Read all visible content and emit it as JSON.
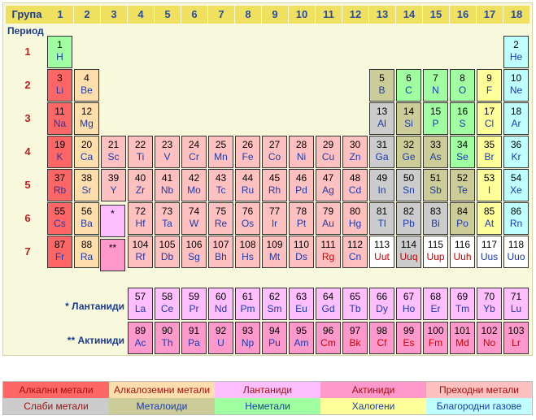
{
  "header": {
    "group_label": "Група",
    "groups": [
      "1",
      "2",
      "3",
      "4",
      "5",
      "6",
      "7",
      "8",
      "9",
      "10",
      "11",
      "12",
      "13",
      "14",
      "15",
      "16",
      "17",
      "18"
    ]
  },
  "period_label": "Период",
  "periods": [
    "1",
    "2",
    "3",
    "4",
    "5",
    "6",
    "7"
  ],
  "families": {
    "lanthanides_label": "* Лантаниди",
    "actinides_label": "** Актиниди",
    "lanthanide_marker": "*",
    "actinide_marker": "**"
  },
  "colors": {
    "alkali": "#ff6666",
    "alkaline_earth": "#ffdead",
    "lanthanide": "#ffbfff",
    "actinide": "#ff99cc",
    "transition": "#ffc0c0",
    "poor_metal": "#cccccc",
    "metalloid": "#cccc99",
    "nonmetal": "#a0ffa0",
    "halogen": "#ffff99",
    "noble_gas": "#c0ffff"
  },
  "elements": [
    {
      "n": "1",
      "s": "H",
      "r": 1,
      "c": 1,
      "t": "nonmetal"
    },
    {
      "n": "2",
      "s": "He",
      "r": 1,
      "c": 18,
      "t": "noble_gas"
    },
    {
      "n": "3",
      "s": "Li",
      "r": 2,
      "c": 1,
      "t": "alkali"
    },
    {
      "n": "4",
      "s": "Be",
      "r": 2,
      "c": 2,
      "t": "alkaline_earth"
    },
    {
      "n": "5",
      "s": "B",
      "r": 2,
      "c": 13,
      "t": "metalloid"
    },
    {
      "n": "6",
      "s": "C",
      "r": 2,
      "c": 14,
      "t": "nonmetal"
    },
    {
      "n": "7",
      "s": "N",
      "r": 2,
      "c": 15,
      "t": "nonmetal"
    },
    {
      "n": "8",
      "s": "O",
      "r": 2,
      "c": 16,
      "t": "nonmetal"
    },
    {
      "n": "9",
      "s": "F",
      "r": 2,
      "c": 17,
      "t": "halogen"
    },
    {
      "n": "10",
      "s": "Ne",
      "r": 2,
      "c": 18,
      "t": "noble_gas"
    },
    {
      "n": "11",
      "s": "Na",
      "r": 3,
      "c": 1,
      "t": "alkali"
    },
    {
      "n": "12",
      "s": "Mg",
      "r": 3,
      "c": 2,
      "t": "alkaline_earth"
    },
    {
      "n": "13",
      "s": "Al",
      "r": 3,
      "c": 13,
      "t": "poor_metal"
    },
    {
      "n": "14",
      "s": "Si",
      "r": 3,
      "c": 14,
      "t": "metalloid"
    },
    {
      "n": "15",
      "s": "P",
      "r": 3,
      "c": 15,
      "t": "nonmetal"
    },
    {
      "n": "16",
      "s": "S",
      "r": 3,
      "c": 16,
      "t": "nonmetal"
    },
    {
      "n": "17",
      "s": "Cl",
      "r": 3,
      "c": 17,
      "t": "halogen"
    },
    {
      "n": "18",
      "s": "Ar",
      "r": 3,
      "c": 18,
      "t": "noble_gas"
    },
    {
      "n": "19",
      "s": "K",
      "r": 4,
      "c": 1,
      "t": "alkali"
    },
    {
      "n": "20",
      "s": "Ca",
      "r": 4,
      "c": 2,
      "t": "alkaline_earth"
    },
    {
      "n": "21",
      "s": "Sc",
      "r": 4,
      "c": 3,
      "t": "transition"
    },
    {
      "n": "22",
      "s": "Ti",
      "r": 4,
      "c": 4,
      "t": "transition"
    },
    {
      "n": "23",
      "s": "V",
      "r": 4,
      "c": 5,
      "t": "transition"
    },
    {
      "n": "24",
      "s": "Cr",
      "r": 4,
      "c": 6,
      "t": "transition"
    },
    {
      "n": "25",
      "s": "Mn",
      "r": 4,
      "c": 7,
      "t": "transition"
    },
    {
      "n": "26",
      "s": "Fe",
      "r": 4,
      "c": 8,
      "t": "transition"
    },
    {
      "n": "27",
      "s": "Co",
      "r": 4,
      "c": 9,
      "t": "transition"
    },
    {
      "n": "28",
      "s": "Ni",
      "r": 4,
      "c": 10,
      "t": "transition"
    },
    {
      "n": "29",
      "s": "Cu",
      "r": 4,
      "c": 11,
      "t": "transition"
    },
    {
      "n": "30",
      "s": "Zn",
      "r": 4,
      "c": 12,
      "t": "transition"
    },
    {
      "n": "31",
      "s": "Ga",
      "r": 4,
      "c": 13,
      "t": "poor_metal"
    },
    {
      "n": "32",
      "s": "Ge",
      "r": 4,
      "c": 14,
      "t": "metalloid"
    },
    {
      "n": "33",
      "s": "As",
      "r": 4,
      "c": 15,
      "t": "metalloid"
    },
    {
      "n": "34",
      "s": "Se",
      "r": 4,
      "c": 16,
      "t": "nonmetal"
    },
    {
      "n": "35",
      "s": "Br",
      "r": 4,
      "c": 17,
      "t": "halogen"
    },
    {
      "n": "36",
      "s": "Kr",
      "r": 4,
      "c": 18,
      "t": "noble_gas"
    },
    {
      "n": "37",
      "s": "Rb",
      "r": 5,
      "c": 1,
      "t": "alkali"
    },
    {
      "n": "38",
      "s": "Sr",
      "r": 5,
      "c": 2,
      "t": "alkaline_earth"
    },
    {
      "n": "39",
      "s": "Y",
      "r": 5,
      "c": 3,
      "t": "transition"
    },
    {
      "n": "40",
      "s": "Zr",
      "r": 5,
      "c": 4,
      "t": "transition"
    },
    {
      "n": "41",
      "s": "Nb",
      "r": 5,
      "c": 5,
      "t": "transition"
    },
    {
      "n": "42",
      "s": "Mo",
      "r": 5,
      "c": 6,
      "t": "transition"
    },
    {
      "n": "43",
      "s": "Tc",
      "r": 5,
      "c": 7,
      "t": "transition"
    },
    {
      "n": "44",
      "s": "Ru",
      "r": 5,
      "c": 8,
      "t": "transition"
    },
    {
      "n": "45",
      "s": "Rh",
      "r": 5,
      "c": 9,
      "t": "transition"
    },
    {
      "n": "46",
      "s": "Pd",
      "r": 5,
      "c": 10,
      "t": "transition"
    },
    {
      "n": "47",
      "s": "Ag",
      "r": 5,
      "c": 11,
      "t": "transition"
    },
    {
      "n": "48",
      "s": "Cd",
      "r": 5,
      "c": 12,
      "t": "transition"
    },
    {
      "n": "49",
      "s": "In",
      "r": 5,
      "c": 13,
      "t": "poor_metal"
    },
    {
      "n": "50",
      "s": "Sn",
      "r": 5,
      "c": 14,
      "t": "poor_metal"
    },
    {
      "n": "51",
      "s": "Sb",
      "r": 5,
      "c": 15,
      "t": "metalloid"
    },
    {
      "n": "52",
      "s": "Te",
      "r": 5,
      "c": 16,
      "t": "metalloid"
    },
    {
      "n": "53",
      "s": "I",
      "r": 5,
      "c": 17,
      "t": "halogen"
    },
    {
      "n": "54",
      "s": "Xe",
      "r": 5,
      "c": 18,
      "t": "noble_gas"
    },
    {
      "n": "55",
      "s": "Cs",
      "r": 6,
      "c": 1,
      "t": "alkali"
    },
    {
      "n": "56",
      "s": "Ba",
      "r": 6,
      "c": 2,
      "t": "alkaline_earth"
    },
    {
      "n": "72",
      "s": "Hf",
      "r": 6,
      "c": 4,
      "t": "transition"
    },
    {
      "n": "73",
      "s": "Ta",
      "r": 6,
      "c": 5,
      "t": "transition"
    },
    {
      "n": "74",
      "s": "W",
      "r": 6,
      "c": 6,
      "t": "transition"
    },
    {
      "n": "75",
      "s": "Re",
      "r": 6,
      "c": 7,
      "t": "transition"
    },
    {
      "n": "76",
      "s": "Os",
      "r": 6,
      "c": 8,
      "t": "transition"
    },
    {
      "n": "77",
      "s": "Ir",
      "r": 6,
      "c": 9,
      "t": "transition"
    },
    {
      "n": "78",
      "s": "Pt",
      "r": 6,
      "c": 10,
      "t": "transition"
    },
    {
      "n": "79",
      "s": "Au",
      "r": 6,
      "c": 11,
      "t": "transition"
    },
    {
      "n": "80",
      "s": "Hg",
      "r": 6,
      "c": 12,
      "t": "transition"
    },
    {
      "n": "81",
      "s": "Tl",
      "r": 6,
      "c": 13,
      "t": "poor_metal"
    },
    {
      "n": "82",
      "s": "Pb",
      "r": 6,
      "c": 14,
      "t": "poor_metal"
    },
    {
      "n": "83",
      "s": "Bi",
      "r": 6,
      "c": 15,
      "t": "poor_metal"
    },
    {
      "n": "84",
      "s": "Po",
      "r": 6,
      "c": 16,
      "t": "metalloid"
    },
    {
      "n": "85",
      "s": "At",
      "r": 6,
      "c": 17,
      "t": "halogen"
    },
    {
      "n": "86",
      "s": "Rn",
      "r": 6,
      "c": 18,
      "t": "noble_gas"
    },
    {
      "n": "87",
      "s": "Fr",
      "r": 7,
      "c": 1,
      "t": "alkali"
    },
    {
      "n": "88",
      "s": "Ra",
      "r": 7,
      "c": 2,
      "t": "alkaline_earth"
    },
    {
      "n": "104",
      "s": "Rf",
      "r": 7,
      "c": 4,
      "t": "transition"
    },
    {
      "n": "105",
      "s": "Db",
      "r": 7,
      "c": 5,
      "t": "transition"
    },
    {
      "n": "106",
      "s": "Sg",
      "r": 7,
      "c": 6,
      "t": "transition"
    },
    {
      "n": "107",
      "s": "Bh",
      "r": 7,
      "c": 7,
      "t": "transition"
    },
    {
      "n": "108",
      "s": "Hs",
      "r": 7,
      "c": 8,
      "t": "transition"
    },
    {
      "n": "109",
      "s": "Mt",
      "r": 7,
      "c": 9,
      "t": "transition"
    },
    {
      "n": "110",
      "s": "Ds",
      "r": 7,
      "c": 10,
      "t": "transition"
    },
    {
      "n": "111",
      "s": "Rg",
      "r": 7,
      "c": 11,
      "t": "transition",
      "red": true
    },
    {
      "n": "112",
      "s": "Cn",
      "r": 7,
      "c": 12,
      "t": "transition"
    },
    {
      "n": "113",
      "s": "Uut",
      "r": 7,
      "c": 13,
      "t": "unknown",
      "red": true
    },
    {
      "n": "114",
      "s": "Uuq",
      "r": 7,
      "c": 14,
      "t": "poor_metal",
      "red": true
    },
    {
      "n": "115",
      "s": "Uup",
      "r": 7,
      "c": 15,
      "t": "unknown",
      "red": true
    },
    {
      "n": "116",
      "s": "Uuh",
      "r": 7,
      "c": 16,
      "t": "unknown",
      "red": true
    },
    {
      "n": "117",
      "s": "Uus",
      "r": 7,
      "c": 17,
      "t": "unknown"
    },
    {
      "n": "118",
      "s": "Uuo",
      "r": 7,
      "c": 18,
      "t": "unknown"
    },
    {
      "n": "57",
      "s": "La",
      "r": 8,
      "c": 4,
      "t": "lanthanide"
    },
    {
      "n": "58",
      "s": "Ce",
      "r": 8,
      "c": 5,
      "t": "lanthanide"
    },
    {
      "n": "59",
      "s": "Pr",
      "r": 8,
      "c": 6,
      "t": "lanthanide"
    },
    {
      "n": "60",
      "s": "Nd",
      "r": 8,
      "c": 7,
      "t": "lanthanide"
    },
    {
      "n": "61",
      "s": "Pm",
      "r": 8,
      "c": 8,
      "t": "lanthanide"
    },
    {
      "n": "62",
      "s": "Sm",
      "r": 8,
      "c": 9,
      "t": "lanthanide"
    },
    {
      "n": "63",
      "s": "Eu",
      "r": 8,
      "c": 10,
      "t": "lanthanide"
    },
    {
      "n": "64",
      "s": "Gd",
      "r": 8,
      "c": 11,
      "t": "lanthanide"
    },
    {
      "n": "65",
      "s": "Tb",
      "r": 8,
      "c": 12,
      "t": "lanthanide"
    },
    {
      "n": "66",
      "s": "Dy",
      "r": 8,
      "c": 13,
      "t": "lanthanide"
    },
    {
      "n": "67",
      "s": "Ho",
      "r": 8,
      "c": 14,
      "t": "lanthanide"
    },
    {
      "n": "68",
      "s": "Er",
      "r": 8,
      "c": 15,
      "t": "lanthanide"
    },
    {
      "n": "69",
      "s": "Tm",
      "r": 8,
      "c": 16,
      "t": "lanthanide"
    },
    {
      "n": "70",
      "s": "Yb",
      "r": 8,
      "c": 17,
      "t": "lanthanide"
    },
    {
      "n": "71",
      "s": "Lu",
      "r": 8,
      "c": 18,
      "t": "lanthanide"
    },
    {
      "n": "89",
      "s": "Ac",
      "r": 9,
      "c": 4,
      "t": "actinide"
    },
    {
      "n": "90",
      "s": "Th",
      "r": 9,
      "c": 5,
      "t": "actinide"
    },
    {
      "n": "91",
      "s": "Pa",
      "r": 9,
      "c": 6,
      "t": "actinide"
    },
    {
      "n": "92",
      "s": "U",
      "r": 9,
      "c": 7,
      "t": "actinide"
    },
    {
      "n": "93",
      "s": "Np",
      "r": 9,
      "c": 8,
      "t": "actinide"
    },
    {
      "n": "94",
      "s": "Pu",
      "r": 9,
      "c": 9,
      "t": "actinide"
    },
    {
      "n": "95",
      "s": "Am",
      "r": 9,
      "c": 10,
      "t": "actinide"
    },
    {
      "n": "96",
      "s": "Cm",
      "r": 9,
      "c": 11,
      "t": "actinide",
      "red": true
    },
    {
      "n": "97",
      "s": "Bk",
      "r": 9,
      "c": 12,
      "t": "actinide",
      "red": true
    },
    {
      "n": "98",
      "s": "Cf",
      "r": 9,
      "c": 13,
      "t": "actinide",
      "red": true
    },
    {
      "n": "99",
      "s": "Es",
      "r": 9,
      "c": 14,
      "t": "actinide",
      "red": true
    },
    {
      "n": "100",
      "s": "Fm",
      "r": 9,
      "c": 15,
      "t": "actinide",
      "red": true
    },
    {
      "n": "101",
      "s": "Md",
      "r": 9,
      "c": 16,
      "t": "actinide",
      "red": true
    },
    {
      "n": "102",
      "s": "No",
      "r": 9,
      "c": 17,
      "t": "actinide",
      "red": true
    },
    {
      "n": "103",
      "s": "Lr",
      "r": 9,
      "c": 18,
      "t": "actinide",
      "red": true
    }
  ],
  "legend": [
    {
      "label": "Алкални метали",
      "t": "alkali"
    },
    {
      "label": "Алкалоземни метали",
      "t": "alkaline_earth"
    },
    {
      "label": "Лантаниди",
      "t": "lanthanide"
    },
    {
      "label": "Актиниди",
      "t": "actinide"
    },
    {
      "label": "Преходни метали",
      "t": "transition"
    },
    {
      "label": "Слаби метали",
      "t": "poor_metal"
    },
    {
      "label": "Металоиди",
      "t": "metalloid"
    },
    {
      "label": "Неметали",
      "t": "nonmetal"
    },
    {
      "label": "Халогени",
      "t": "halogen"
    },
    {
      "label": "Благородни газове",
      "t": "noble_gas"
    }
  ]
}
